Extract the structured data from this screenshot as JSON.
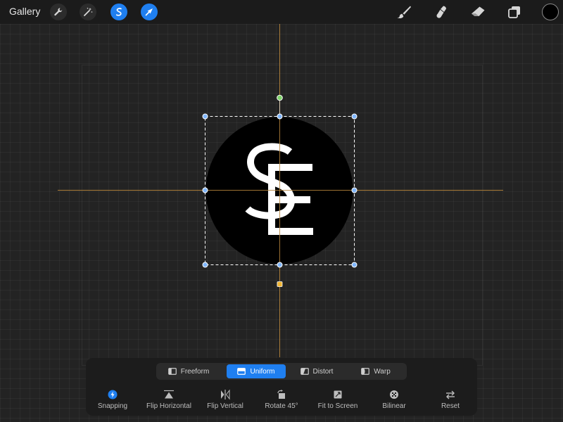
{
  "topbar": {
    "gallery_label": "Gallery",
    "tools": [
      {
        "icon": "wrench-icon",
        "name": "actions"
      },
      {
        "icon": "magic-wand-icon",
        "name": "adjustments"
      },
      {
        "icon": "selection-s-icon",
        "name": "selection"
      },
      {
        "icon": "transform-arrow-icon",
        "name": "transform"
      }
    ],
    "right_tools": [
      {
        "icon": "brush-icon",
        "name": "paint"
      },
      {
        "icon": "smudge-icon",
        "name": "smudge"
      },
      {
        "icon": "eraser-icon",
        "name": "erase"
      },
      {
        "icon": "layers-icon",
        "name": "layers"
      }
    ],
    "current_color": "#000000"
  },
  "canvas": {
    "artwork_text": "SE",
    "guide_color": "#b8863c",
    "handle_color": "#7fb6ff",
    "rotate_handle_color": "#7fd36b",
    "anchor_color": "#f2b632"
  },
  "panel": {
    "modes": [
      {
        "label": "Freeform",
        "icon": "freeform-icon",
        "active": false
      },
      {
        "label": "Uniform",
        "icon": "uniform-icon",
        "active": true
      },
      {
        "label": "Distort",
        "icon": "distort-icon",
        "active": false
      },
      {
        "label": "Warp",
        "icon": "warp-icon",
        "active": false
      }
    ],
    "actions": [
      {
        "label": "Snapping",
        "icon": "lightning-icon"
      },
      {
        "label": "Flip Horizontal",
        "icon": "flip-horizontal-icon"
      },
      {
        "label": "Flip Vertical",
        "icon": "flip-vertical-icon"
      },
      {
        "label": "Rotate 45°",
        "icon": "rotate-icon"
      },
      {
        "label": "Fit to Screen",
        "icon": "fit-screen-icon"
      },
      {
        "label": "Bilinear",
        "icon": "bilinear-icon"
      },
      {
        "label": "Reset",
        "icon": "reset-icon"
      }
    ],
    "accent_color": "#1f7ff0"
  }
}
